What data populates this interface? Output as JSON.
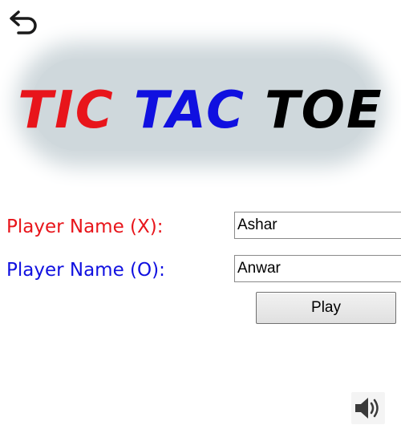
{
  "title": {
    "words": [
      "TIC",
      "TAC",
      "TOE"
    ],
    "colors": [
      "#e8151b",
      "#1010e0",
      "#000000"
    ]
  },
  "back_button": {
    "icon": "back-arrow-icon"
  },
  "form": {
    "player_x": {
      "label": "Player Name (X):",
      "value": "Ashar",
      "color": "#e8151b"
    },
    "player_o": {
      "label": "Player Name (O):",
      "value": "Anwar",
      "color": "#1010e0"
    }
  },
  "play_button": {
    "label": "Play"
  },
  "sound_button": {
    "icon": "speaker-icon"
  }
}
